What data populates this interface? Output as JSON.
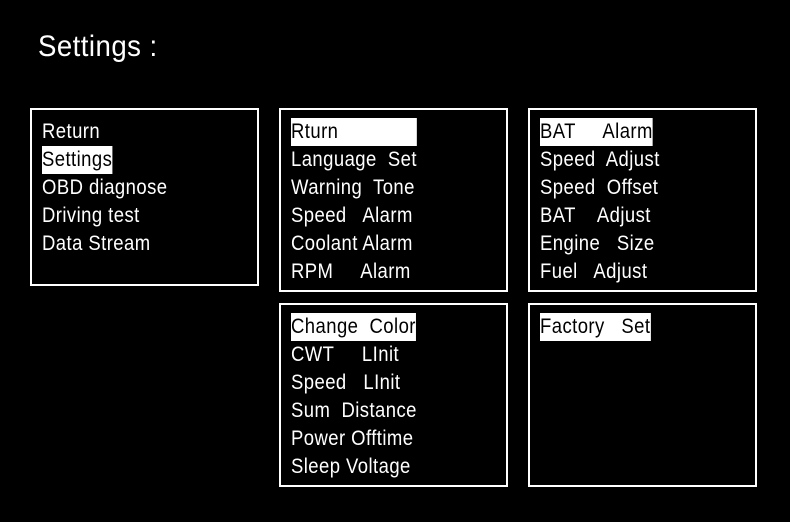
{
  "title": "Settings :",
  "panels": [
    {
      "id": "main-menu",
      "items": [
        {
          "label": "Return",
          "selected": false
        },
        {
          "label": "Settings",
          "selected": true
        },
        {
          "label": "OBD diagnose",
          "selected": false
        },
        {
          "label": "Driving test",
          "selected": false
        },
        {
          "label": "Data Stream",
          "selected": false
        }
      ]
    },
    {
      "id": "settings-page-1",
      "items": [
        {
          "label": "Rturn              ",
          "selected": true
        },
        {
          "label": "Language  Set",
          "selected": false
        },
        {
          "label": "Warning  Tone",
          "selected": false
        },
        {
          "label": "Speed   Alarm",
          "selected": false
        },
        {
          "label": "Coolant Alarm",
          "selected": false
        },
        {
          "label": "RPM     Alarm",
          "selected": false
        }
      ]
    },
    {
      "id": "settings-page-2",
      "items": [
        {
          "label": "BAT     Alarm",
          "selected": true
        },
        {
          "label": "Speed  Adjust",
          "selected": false
        },
        {
          "label": "Speed  Offset",
          "selected": false
        },
        {
          "label": "BAT    Adjust",
          "selected": false
        },
        {
          "label": "Engine   Size",
          "selected": false
        },
        {
          "label": "Fuel   Adjust",
          "selected": false
        }
      ]
    },
    {
      "id": "settings-page-3",
      "items": [
        {
          "label": "Change  Color",
          "selected": true
        },
        {
          "label": "CWT     LInit",
          "selected": false
        },
        {
          "label": "Speed   LInit",
          "selected": false
        },
        {
          "label": "Sum  Distance",
          "selected": false
        },
        {
          "label": "Power Offtime",
          "selected": false
        },
        {
          "label": "Sleep Voltage",
          "selected": false
        }
      ]
    },
    {
      "id": "settings-page-4",
      "items": [
        {
          "label": "Factory   Set",
          "selected": true
        }
      ]
    }
  ]
}
